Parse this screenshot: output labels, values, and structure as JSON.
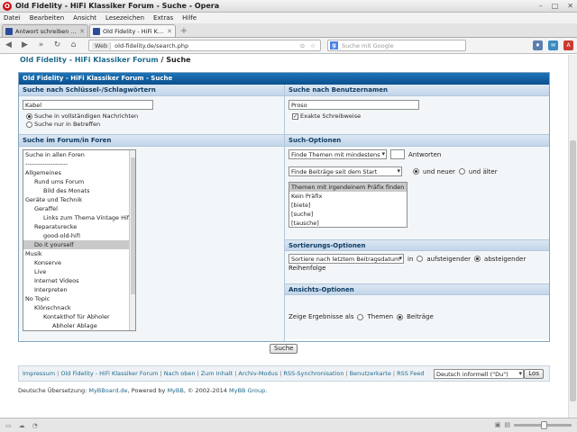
{
  "window": {
    "title": "Old Fidelity - HiFi Klassiker Forum - Suche - Opera",
    "controls": [
      "–",
      "□",
      "✕"
    ]
  },
  "menu": [
    "Datei",
    "Bearbeiten",
    "Ansicht",
    "Lesezeichen",
    "Extras",
    "Hilfe"
  ],
  "tabs": [
    {
      "label": "Antwort schreiben an De...",
      "active": false
    },
    {
      "label": "Old Fidelity - HiFi Klassike...",
      "active": true
    }
  ],
  "address": {
    "badge": "Web",
    "url": "old-fidelity.de/search.php",
    "search_placeholder": "Suche mit Google"
  },
  "breadcrumb": {
    "forum": "Old Fidelity - HiFi Klassiker Forum",
    "sep": " / ",
    "current": "Suche"
  },
  "panel": {
    "title": "Old Fidelity - HiFi Klassiker Forum - Suche",
    "keywords": {
      "heading": "Suche nach Schlüssel-/Schlagwörtern",
      "value": "Kabel",
      "option_full": "Suche in vollständigen Nachrichten",
      "option_titles": "Suche nur in Betreffen"
    },
    "user": {
      "heading": "Suche nach Benutzernamen",
      "value": "Proso",
      "exact": "Exakte Schreibweise"
    },
    "forums": {
      "heading": "Suche im Forum/in Foren",
      "items": [
        {
          "label": "Suche in allen Foren",
          "indent": 0,
          "selected": false
        },
        {
          "label": "--------------------",
          "indent": 0,
          "selected": false
        },
        {
          "label": "Allgemeines",
          "indent": 0,
          "selected": false
        },
        {
          "label": "Rund ums Forum",
          "indent": 1,
          "selected": false
        },
        {
          "label": "Bild des Monats",
          "indent": 2,
          "selected": false
        },
        {
          "label": "Geräte und Technik",
          "indent": 0,
          "selected": false
        },
        {
          "label": "Geraffel",
          "indent": 1,
          "selected": false
        },
        {
          "label": "Links zum Thema Vintage Hifi",
          "indent": 2,
          "selected": false
        },
        {
          "label": "Reparaturecke",
          "indent": 1,
          "selected": false
        },
        {
          "label": "good-old-hifi",
          "indent": 2,
          "selected": false
        },
        {
          "label": "Do it yourself",
          "indent": 1,
          "selected": true
        },
        {
          "label": "Musik",
          "indent": 0,
          "selected": false
        },
        {
          "label": "Konserve",
          "indent": 1,
          "selected": false
        },
        {
          "label": "Live",
          "indent": 1,
          "selected": false
        },
        {
          "label": "Internet Videos",
          "indent": 1,
          "selected": false
        },
        {
          "label": "Interpreten",
          "indent": 1,
          "selected": false
        },
        {
          "label": "No Topic",
          "indent": 0,
          "selected": false
        },
        {
          "label": "Klönschnack",
          "indent": 1,
          "selected": false
        },
        {
          "label": "Kontakthof für Abholer",
          "indent": 2,
          "selected": false
        },
        {
          "label": "Abholer Ablage",
          "indent": 3,
          "selected": false
        }
      ]
    },
    "options": {
      "heading": "Such-Optionen",
      "min_replies_select": "Finde Themen mit mindestens",
      "min_replies_value": "",
      "replies_label": "Antworten",
      "date_select": "Finde Beiträge seit dem Start",
      "newer": "und neuer",
      "older": "und älter",
      "prefixes": [
        "Themen mit irgendeinem Präfix finden",
        "Kein Präfix",
        "[biete]",
        "[suche]",
        "[tausche]"
      ]
    },
    "sort": {
      "heading": "Sortierungs-Optionen",
      "select": "Sortiere nach letztem Beitragsdatum",
      "in": "in",
      "asc": "aufsteigender",
      "desc": "absteigender",
      "order": "Reihenfolge"
    },
    "display": {
      "heading": "Ansichts-Optionen",
      "label": "Zeige Ergebnisse als",
      "threads": "Themen",
      "posts": "Beiträge"
    },
    "submit": "Suche"
  },
  "footer": {
    "links": [
      "Impressum",
      "Old Fidelity - HiFi Klassiker Forum",
      "Nach oben",
      "Zum Inhalt",
      "Archiv-Modus",
      "RSS-Synchronisation",
      "Benutzerkarte",
      "RSS Feed"
    ],
    "language": "Deutsch informell (\"Du\")",
    "go": "Los",
    "translation_prefix": "Deutsche Übersetzung: ",
    "translation_link": "MyBBoard.de",
    "powered_prefix": ", Powered by ",
    "powered_link": "MyBB",
    "copyright_mid": ", © 2002-2014 ",
    "group_link": "MyBB Group",
    "end": "."
  },
  "colors": {
    "header": "#0b4f8e",
    "link": "#1f6b8e",
    "subhead": "#c2d5ea",
    "opera": "#cc0f16"
  }
}
